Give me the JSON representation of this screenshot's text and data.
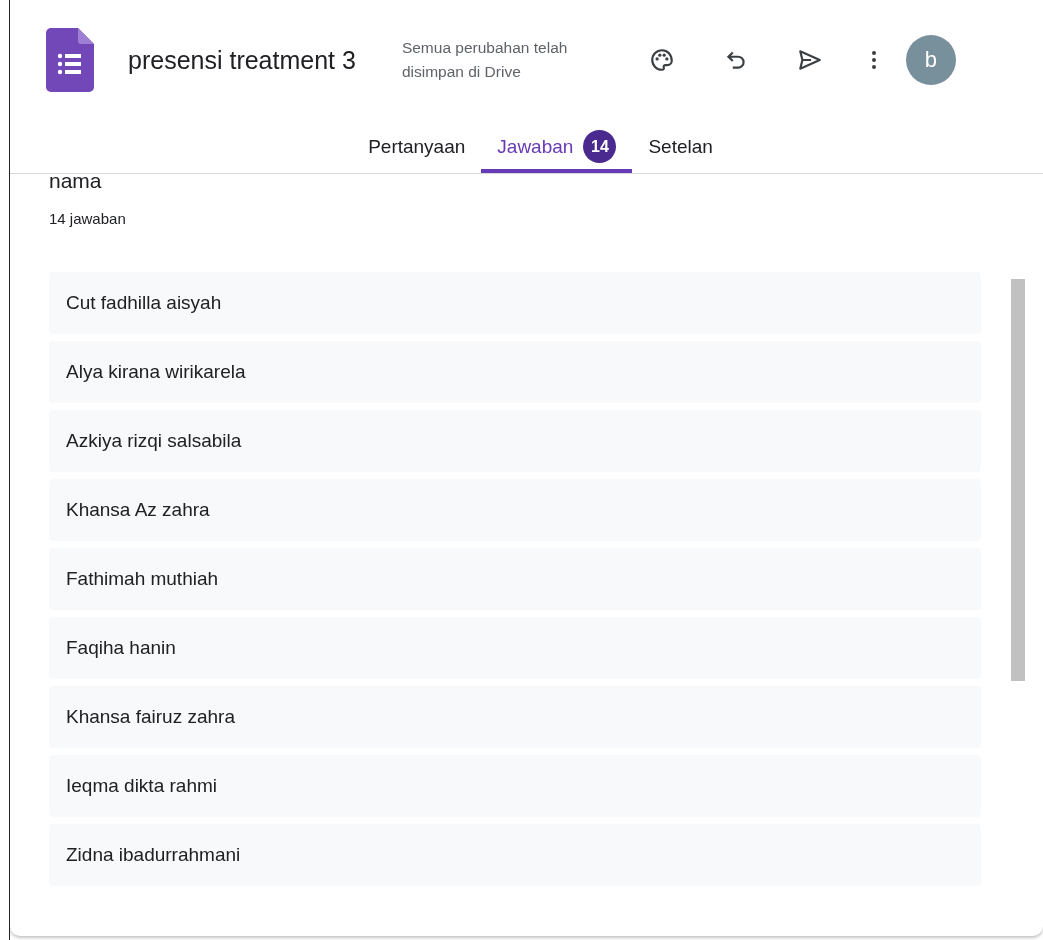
{
  "header": {
    "title": "presensi treatment 3",
    "save_status": "Semua perubahan telah disimpan di Drive",
    "avatar": "b"
  },
  "tabs": [
    {
      "label": "Pertanyaan",
      "selected": false
    },
    {
      "label": "Jawaban",
      "selected": true,
      "badge": "14"
    },
    {
      "label": "Setelan",
      "selected": false
    }
  ],
  "question": {
    "title": "nama",
    "count": "14 jawaban"
  },
  "answers": [
    "Cut fadhilla aisyah",
    "Alya kirana wirikarela",
    "Azkiya rizqi salsabila",
    "Khansa Az zahra",
    "Fathimah muthiah",
    "Faqiha hanin",
    "Khansa fairuz zahra",
    "Ieqma dikta rahmi",
    "Zidna ibadurrahmani"
  ]
}
